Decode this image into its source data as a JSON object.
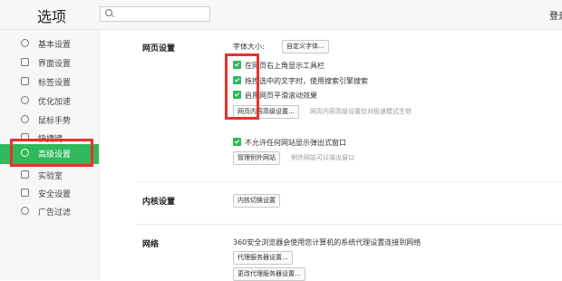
{
  "header": {
    "title": "选项",
    "login": "登录"
  },
  "sidebar": {
    "items": [
      {
        "label": "基本设置",
        "icon": "settings-icon"
      },
      {
        "label": "界面设置",
        "icon": "window-icon"
      },
      {
        "label": "标签设置",
        "icon": "tag-icon"
      },
      {
        "label": "优化加速",
        "icon": "rocket-icon"
      },
      {
        "label": "鼠标手势",
        "icon": "mouse-icon"
      },
      {
        "label": "快捷键",
        "icon": "keyboard-icon"
      },
      {
        "label": "高级设置",
        "icon": "advanced-icon",
        "active": true
      },
      {
        "label": "实验室",
        "icon": "lab-icon"
      },
      {
        "label": "安全设置",
        "icon": "shield-icon"
      },
      {
        "label": "广告过滤",
        "icon": "block-icon"
      }
    ]
  },
  "main": {
    "webpage": {
      "title": "网页设置",
      "font_size_label": "字体大小:",
      "custom_font_button": "自定义字体...",
      "checkboxes": [
        "在网页右上角显示工具栏",
        "拖拽选中的文字时，使用搜索引擎搜索",
        "启用网页平滑滚动效果"
      ],
      "advanced_button": "网页内容高级设置...",
      "advanced_hint": "网页内容高级设置仅对极速模式生效",
      "popup_checkbox": "不允许任何网站显示弹出式窗口",
      "popup_exceptions_button": "管理例外网站",
      "popup_hint": "例外网站可以弹出窗口"
    },
    "kernel": {
      "title": "内核设置",
      "switch_button": "内核切换设置"
    },
    "network": {
      "title": "网络",
      "desc": "360安全浏览器会使用您计算机的系统代理设置连接到网络",
      "proxy_button": "代理服务器设置...",
      "change_proxy_button": "更改代理服务器设置..."
    }
  },
  "colors": {
    "accent": "#2fb95a",
    "highlight": "#e8322c"
  }
}
